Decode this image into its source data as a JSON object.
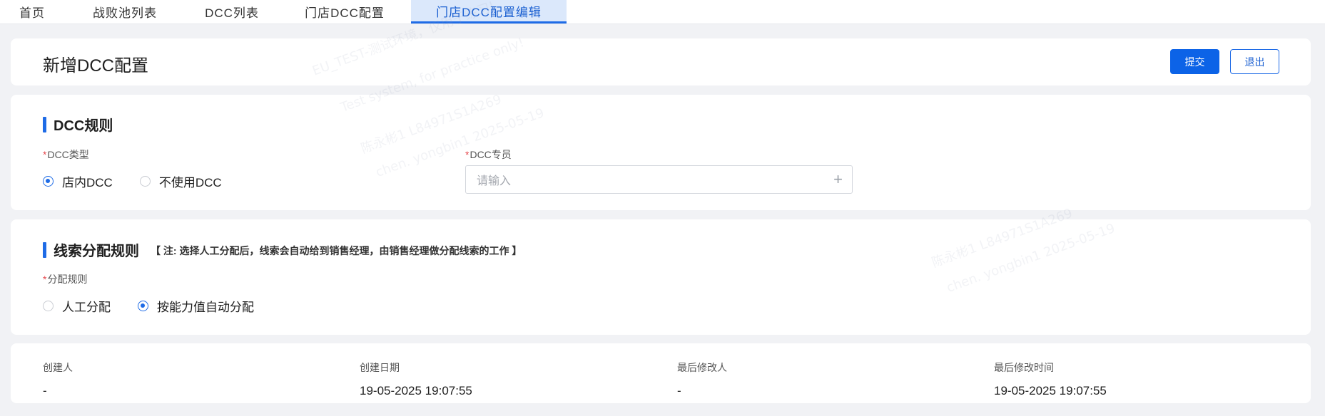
{
  "tabs": [
    {
      "label": "首页",
      "active": false
    },
    {
      "label": "战败池列表",
      "active": false
    },
    {
      "label": "DCC列表",
      "active": false
    },
    {
      "label": "门店DCC配置",
      "active": false
    },
    {
      "label": "门店DCC配置编辑",
      "active": true
    }
  ],
  "header": {
    "title": "新增DCC配置",
    "submit_label": "提交",
    "exit_label": "退出"
  },
  "dcc_rules": {
    "title": "DCC规则",
    "type_field": {
      "label": "DCC类型",
      "options": [
        {
          "label": "店内DCC",
          "checked": true
        },
        {
          "label": "不使用DCC",
          "checked": false
        }
      ]
    },
    "specialist_field": {
      "label": "DCC专员",
      "placeholder": "请输入"
    }
  },
  "lead_rules": {
    "title": "线索分配规则",
    "note": "【 注: 选择人工分配后，线索会自动给到销售经理，由销售经理做分配线索的工作 】",
    "distribution_field": {
      "label": "分配规则",
      "options": [
        {
          "label": "人工分配",
          "checked": false
        },
        {
          "label": "按能力值自动分配",
          "checked": true
        }
      ]
    }
  },
  "meta": {
    "creator_label": "创建人",
    "creator_value": "-",
    "created_date_label": "创建日期",
    "created_date_value": "19-05-2025 19:07:55",
    "modifier_label": "最后修改人",
    "modifier_value": "-",
    "modified_time_label": "最后修改时间",
    "modified_time_value": "19-05-2025 19:07:55"
  },
  "watermark": {
    "line1": "EU_TEST-测试环境，仅用于练习!",
    "line2": "Test system, for practice only!",
    "line3": "陈永彬1 L84971S1A269",
    "line4": "chen. yongbin1 2025-05-19"
  },
  "colors": {
    "accent": "#1e6be6",
    "primary_button": "#0c63e7",
    "required": "#e5484d",
    "background": "#f1f2f5"
  }
}
